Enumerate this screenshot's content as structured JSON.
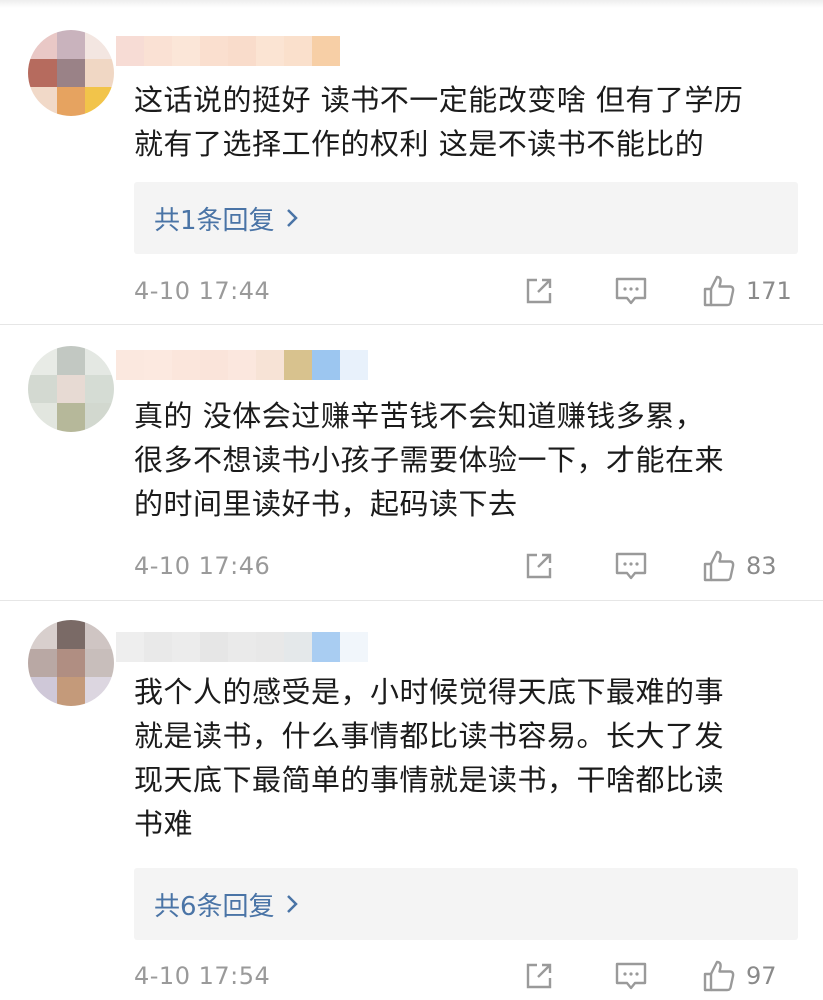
{
  "comments": [
    {
      "text": "这话说的挺好 读书不一定能改变啥 但有了学历\n就有了选择工作的权利 这是不读书不能比的",
      "reply_label": "共1条回复",
      "time": "4-10 17:44",
      "likes": "171"
    },
    {
      "text": "真的 没体会过赚辛苦钱不会知道赚钱多累，\n很多不想读书小孩子需要体验一下，才能在来\n的时间里读好书，起码读下去",
      "time": "4-10 17:46",
      "likes": "83"
    },
    {
      "text": "我个人的感受是，小时候觉得天底下最难的事\n就是读书，什么事情都比读书容易。长大了发\n现天底下最简单的事情就是读书，干啥都比读\n书难",
      "reply_label": "共6条回复",
      "time": "4-10 17:54",
      "likes": "97"
    }
  ],
  "icons": {
    "share": "share-icon",
    "comment": "comment-icon",
    "like": "thumbs-up-icon",
    "reply_chevron": "chevron-right-icon"
  },
  "colors": {
    "reply_link": "#4a74a6",
    "meta_text": "#9a9a9a",
    "reply_bg": "#f4f4f4"
  }
}
